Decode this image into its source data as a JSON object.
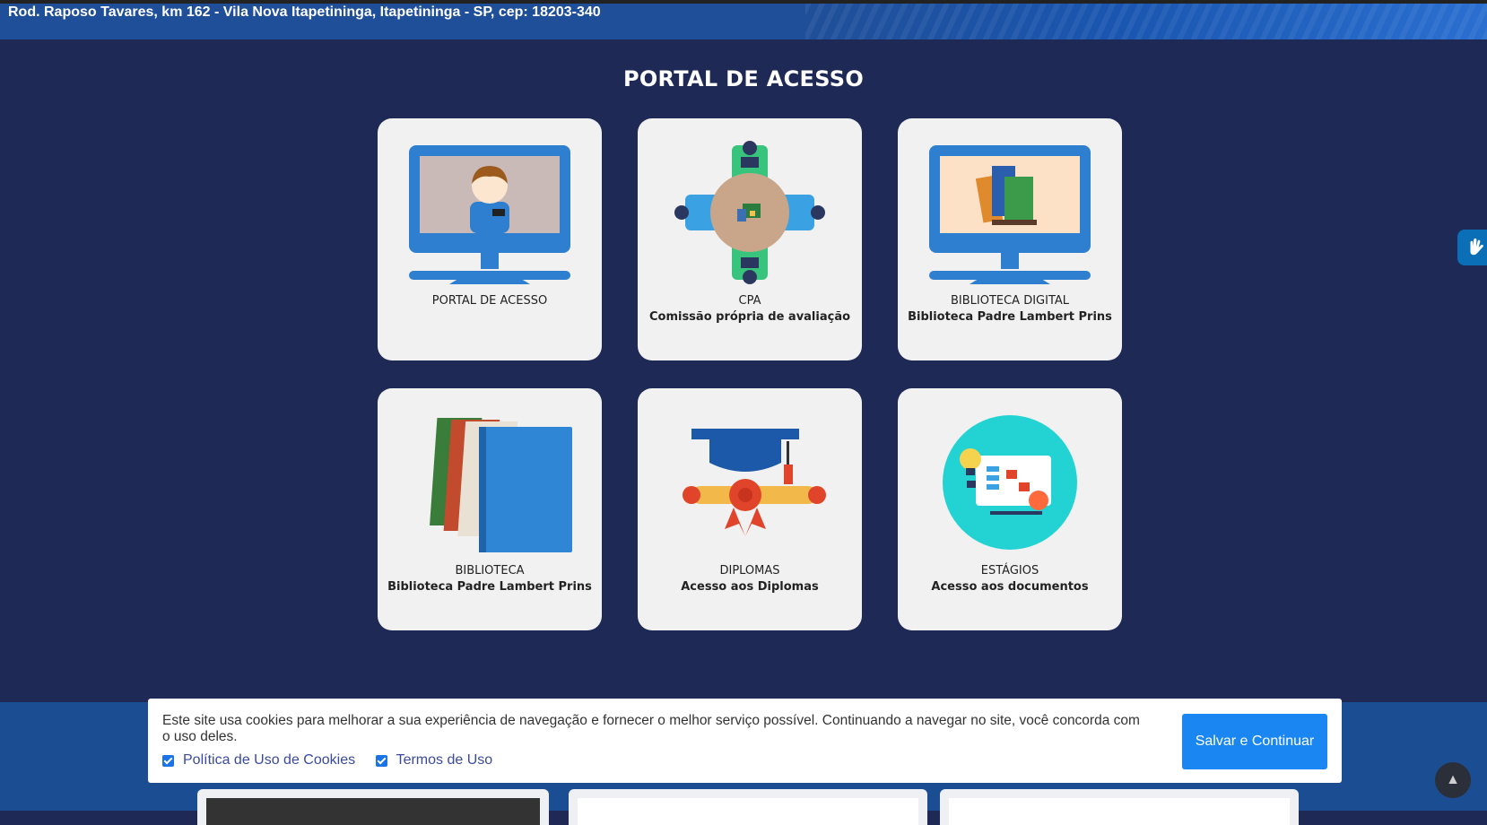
{
  "header": {
    "address": "Rod. Raposo Tavares, km 162 - Vila Nova Itapetininga, Itapetininga - SP, cep: 18203-340"
  },
  "portal": {
    "title": "PORTAL DE ACESSO",
    "cards": [
      {
        "title": "PORTAL DE ACESSO",
        "subtitle": "",
        "icon": "monitor-student-icon"
      },
      {
        "title": "CPA",
        "subtitle": "Comissão própria de avaliação",
        "icon": "meeting-table-icon"
      },
      {
        "title": "BIBLIOTECA DIGITAL",
        "subtitle": "Biblioteca Padre Lambert Prins",
        "icon": "monitor-books-icon"
      },
      {
        "title": "BIBLIOTECA",
        "subtitle": "Biblioteca Padre Lambert Prins",
        "icon": "books-icon"
      },
      {
        "title": "DIPLOMAS",
        "subtitle": "Acesso aos Diplomas",
        "icon": "graduation-cap-diploma-icon"
      },
      {
        "title": "ESTÁGIOS",
        "subtitle": "Acesso aos documentos",
        "icon": "presentation-board-icon"
      }
    ]
  },
  "cookie_banner": {
    "message": "Este site usa cookies para melhorar a sua experiência de navegação e fornecer o melhor serviço possível. Continuando a navegar no site, você concorda com o uso deles.",
    "options": [
      {
        "label": "Política de Uso de Cookies",
        "checked": true
      },
      {
        "label": "Termos de Uso",
        "checked": true
      }
    ],
    "button": "Salvar e Continuar"
  },
  "floating": {
    "accessibility_icon": "hand-sign-language-icon",
    "back_to_top_icon": "up-arrow-icon",
    "back_to_top_glyph": "▲"
  },
  "colors": {
    "page_bg": "#1e2a55",
    "header_bg": "#1f4f99",
    "card_bg": "#f1f1f1",
    "button_bg": "#1a86f2"
  }
}
